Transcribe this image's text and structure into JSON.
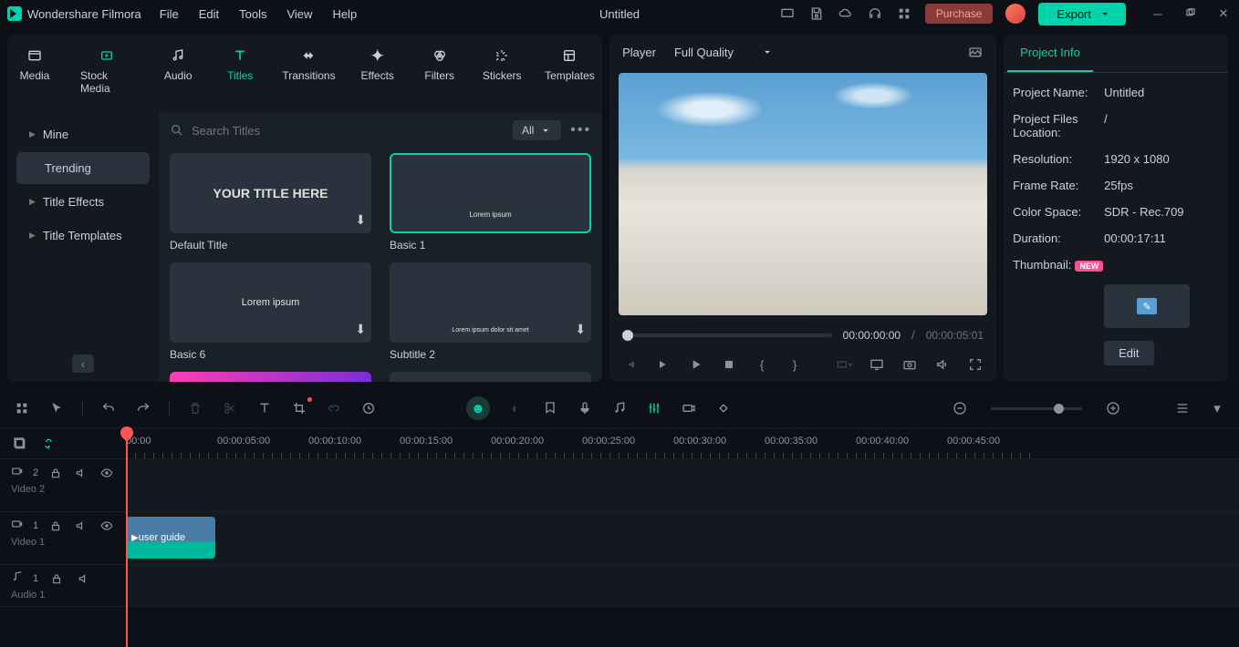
{
  "app_name": "Wondershare Filmora",
  "menu": [
    "File",
    "Edit",
    "Tools",
    "View",
    "Help"
  ],
  "window_title": "Untitled",
  "purchase": "Purchase",
  "export": "Export",
  "tabs": [
    {
      "label": "Media"
    },
    {
      "label": "Stock Media"
    },
    {
      "label": "Audio"
    },
    {
      "label": "Titles",
      "active": true
    },
    {
      "label": "Transitions"
    },
    {
      "label": "Effects"
    },
    {
      "label": "Filters"
    },
    {
      "label": "Stickers"
    },
    {
      "label": "Templates"
    }
  ],
  "sidebar": {
    "items": [
      {
        "label": "Mine"
      },
      {
        "label": "Trending",
        "active": true
      },
      {
        "label": "Title Effects"
      },
      {
        "label": "Title Templates"
      }
    ]
  },
  "search": {
    "placeholder": "Search Titles"
  },
  "filter_all": "All",
  "titles": [
    {
      "name": "Default Title",
      "preview": "YOUR TITLE HERE",
      "dl": true
    },
    {
      "name": "Basic 1",
      "preview": "Lorem ipsum",
      "selected": true,
      "small": true
    },
    {
      "name": "Basic 6",
      "preview": "Lorem ipsum",
      "dl": true
    },
    {
      "name": "Subtitle 2",
      "preview": "Lorem ipsum dolor sit amet",
      "dl": true,
      "small": true
    }
  ],
  "player": {
    "label": "Player",
    "quality": "Full Quality",
    "current_time": "00:00:00:00",
    "total_time": "00:00:05:01"
  },
  "info": {
    "tab": "Project Info",
    "rows": [
      {
        "k": "Project Name:",
        "v": "Untitled"
      },
      {
        "k": "Project Files Location:",
        "v": "/"
      },
      {
        "k": "Resolution:",
        "v": "1920 x 1080"
      },
      {
        "k": "Frame Rate:",
        "v": "25fps"
      },
      {
        "k": "Color Space:",
        "v": "SDR - Rec.709"
      },
      {
        "k": "Duration:",
        "v": "00:00:17:11"
      }
    ],
    "thumbnail_label": "Thumbnail:",
    "new_badge": "NEW",
    "edit": "Edit"
  },
  "timeline": {
    "ruler": [
      "00:00",
      "00:00:05:00",
      "00:00:10:00",
      "00:00:15:00",
      "00:00:20:00",
      "00:00:25:00",
      "00:00:30:00",
      "00:00:35:00",
      "00:00:40:00",
      "00:00:45:00"
    ],
    "tracks": [
      {
        "type": "video",
        "idx": "2",
        "label": "Video 2"
      },
      {
        "type": "video",
        "idx": "1",
        "label": "Video 1",
        "clip": "user guide"
      },
      {
        "type": "audio",
        "idx": "1",
        "label": "Audio 1"
      }
    ]
  }
}
